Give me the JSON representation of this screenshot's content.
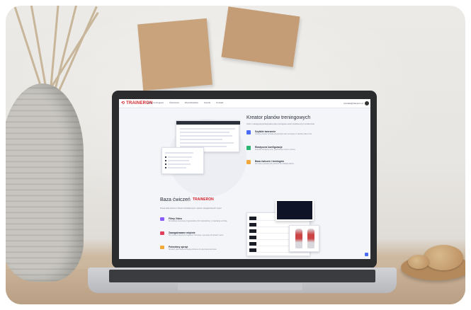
{
  "screen": {
    "brand": "TRAINERON",
    "nav_items": [
      "Plany treningowe",
      "Ćwiczenia",
      "Wyszukiwarka",
      "Cennik",
      "Kontakt"
    ],
    "user_email": "kontakt@traineron.pl",
    "kreator": {
      "title": "Kreator planów treningowych",
      "subtitle": "Twórz i udostępniaj profesjonalne plany treningowe swoim podopiecznym w kilka chwil.",
      "features": [
        {
          "title": "Szybkie tworzenie",
          "desc": "Intuicyjny kreator pozwala przygotować plan treningowy w zaledwie kilka minut.",
          "color": "#4a6cf7"
        },
        {
          "title": "Elastyczne konfiguracje",
          "desc": "Dowolnie konfiguruj serie, powtórzenia, tempo i przerwy.",
          "color": "#2bb673"
        },
        {
          "title": "Baza ćwiczeń i treningów",
          "desc": "Korzystaj z gotowej bazy ćwiczeń lub dodawaj własne.",
          "color": "#f2a93b"
        }
      ]
    },
    "baza": {
      "title": "Baza ćwiczeń",
      "brand": "TRAINERON",
      "subtitle": "Ponad setka ćwiczeń z filmami instruktażowymi i opisem zaangażowanych mięśni.",
      "features": [
        {
          "title": "Filmy Video",
          "desc": "Do każdego ćwiczenia przygotowaliśmy film instruktażowy z prawidłową techniką.",
          "color": "#8a5cf7"
        },
        {
          "title": "Zaangażowane mięśnie",
          "desc": "Przy każdym ćwiczeniu znajdziesz informacje o pracujących partiach mięśni.",
          "color": "#e0405a"
        },
        {
          "title": "Potrzebny sprzęt",
          "desc": "Sprawdź, jakie akcesoria będą potrzebne do wykonania ćwiczenia.",
          "color": "#f2a93b"
        }
      ]
    }
  }
}
